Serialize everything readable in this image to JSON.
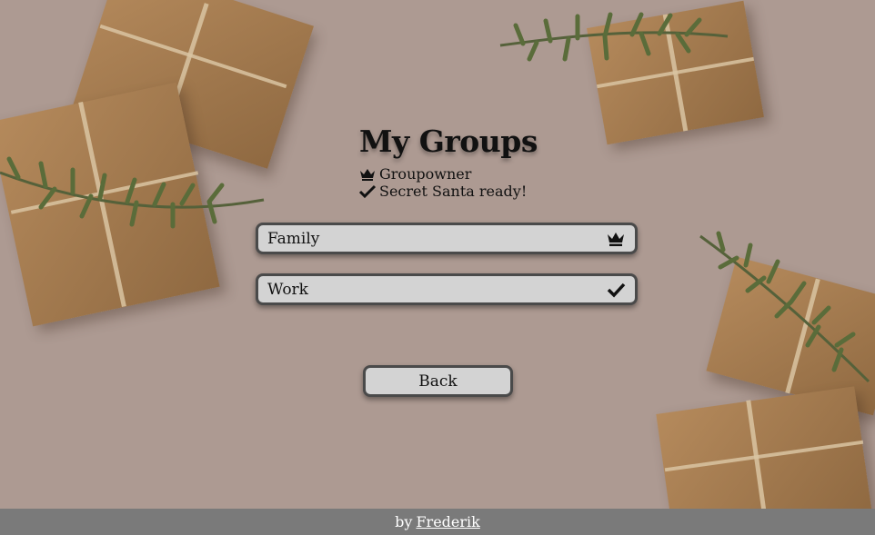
{
  "page": {
    "title": "My Groups",
    "legend": [
      {
        "icon": "crown-icon",
        "label": "Groupowner"
      },
      {
        "icon": "check-icon",
        "label": "Secret Santa ready!"
      }
    ]
  },
  "groups": [
    {
      "name": "Family",
      "icon": "crown-icon"
    },
    {
      "name": "Work",
      "icon": "check-icon"
    }
  ],
  "actions": {
    "back_label": "Back"
  },
  "footer": {
    "prefix": "by",
    "author_link": "Frederik"
  },
  "colors": {
    "background": "#ad9a92",
    "button_bg": "#d3d3d3",
    "button_border": "#4a4a4a",
    "footer_bg": "#7a7a7a"
  }
}
